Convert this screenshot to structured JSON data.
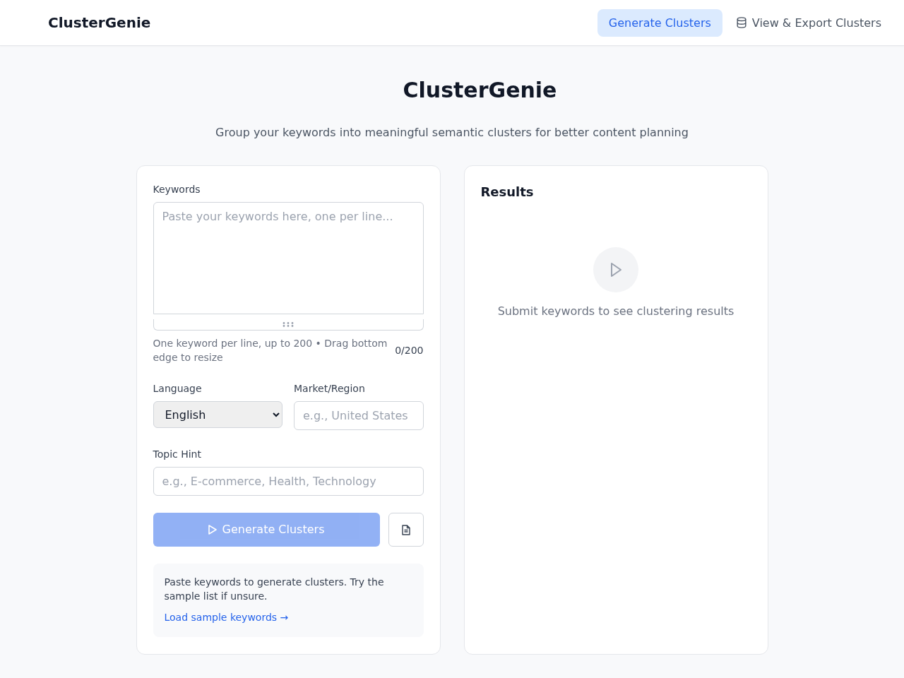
{
  "header": {
    "brand": "ClusterGenie",
    "nav": [
      {
        "label": "Generate Clusters",
        "selected": true,
        "icon": false
      },
      {
        "label": "View & Export Clusters",
        "selected": false,
        "icon": true
      }
    ]
  },
  "hero": {
    "title": "ClusterGenie",
    "subtitle": "Group your keywords into meaningful semantic clusters for better content planning"
  },
  "form": {
    "keywords": {
      "label": "Keywords",
      "placeholder": "Paste your keywords here, one per line...",
      "help": "One keyword per line, up to 200 • Drag bottom edge to resize",
      "counter": "0/200"
    },
    "language": {
      "label": "Language",
      "value": "English"
    },
    "market": {
      "label": "Market/Region",
      "placeholder": "e.g., United States"
    },
    "topic": {
      "label": "Topic Hint",
      "placeholder": "e.g., E-commerce, Health, Technology"
    },
    "generate_button": {
      "label": "Generate Clusters",
      "disabled": true
    },
    "hint": {
      "text": "Paste keywords to generate clusters. Try the sample list if unsure.",
      "link": "Load sample keywords →"
    }
  },
  "results": {
    "title": "Results",
    "empty_message": "Submit keywords to see clustering results"
  }
}
